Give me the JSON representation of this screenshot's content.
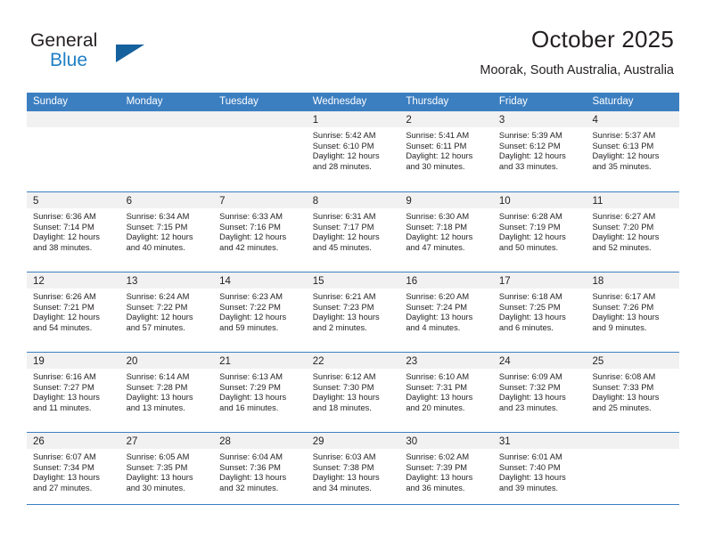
{
  "brand": {
    "word_one": "General",
    "word_two": "Blue",
    "triangle_icon": "triangle-logo-icon",
    "accent_color": "#1f7fc4"
  },
  "header": {
    "title": "October 2025",
    "location": "Moorak, South Australia, Australia"
  },
  "calendar": {
    "header_color": "#3c7fc1",
    "day_band_color": "#f1f1f1",
    "weekdays": [
      "Sunday",
      "Monday",
      "Tuesday",
      "Wednesday",
      "Thursday",
      "Friday",
      "Saturday"
    ],
    "weeks": [
      [
        {
          "day": "",
          "lines": []
        },
        {
          "day": "",
          "lines": []
        },
        {
          "day": "",
          "lines": []
        },
        {
          "day": "1",
          "lines": [
            "Sunrise: 5:42 AM",
            "Sunset: 6:10 PM",
            "Daylight: 12 hours",
            "and 28 minutes."
          ]
        },
        {
          "day": "2",
          "lines": [
            "Sunrise: 5:41 AM",
            "Sunset: 6:11 PM",
            "Daylight: 12 hours",
            "and 30 minutes."
          ]
        },
        {
          "day": "3",
          "lines": [
            "Sunrise: 5:39 AM",
            "Sunset: 6:12 PM",
            "Daylight: 12 hours",
            "and 33 minutes."
          ]
        },
        {
          "day": "4",
          "lines": [
            "Sunrise: 5:37 AM",
            "Sunset: 6:13 PM",
            "Daylight: 12 hours",
            "and 35 minutes."
          ]
        }
      ],
      [
        {
          "day": "5",
          "lines": [
            "Sunrise: 6:36 AM",
            "Sunset: 7:14 PM",
            "Daylight: 12 hours",
            "and 38 minutes."
          ]
        },
        {
          "day": "6",
          "lines": [
            "Sunrise: 6:34 AM",
            "Sunset: 7:15 PM",
            "Daylight: 12 hours",
            "and 40 minutes."
          ]
        },
        {
          "day": "7",
          "lines": [
            "Sunrise: 6:33 AM",
            "Sunset: 7:16 PM",
            "Daylight: 12 hours",
            "and 42 minutes."
          ]
        },
        {
          "day": "8",
          "lines": [
            "Sunrise: 6:31 AM",
            "Sunset: 7:17 PM",
            "Daylight: 12 hours",
            "and 45 minutes."
          ]
        },
        {
          "day": "9",
          "lines": [
            "Sunrise: 6:30 AM",
            "Sunset: 7:18 PM",
            "Daylight: 12 hours",
            "and 47 minutes."
          ]
        },
        {
          "day": "10",
          "lines": [
            "Sunrise: 6:28 AM",
            "Sunset: 7:19 PM",
            "Daylight: 12 hours",
            "and 50 minutes."
          ]
        },
        {
          "day": "11",
          "lines": [
            "Sunrise: 6:27 AM",
            "Sunset: 7:20 PM",
            "Daylight: 12 hours",
            "and 52 minutes."
          ]
        }
      ],
      [
        {
          "day": "12",
          "lines": [
            "Sunrise: 6:26 AM",
            "Sunset: 7:21 PM",
            "Daylight: 12 hours",
            "and 54 minutes."
          ]
        },
        {
          "day": "13",
          "lines": [
            "Sunrise: 6:24 AM",
            "Sunset: 7:22 PM",
            "Daylight: 12 hours",
            "and 57 minutes."
          ]
        },
        {
          "day": "14",
          "lines": [
            "Sunrise: 6:23 AM",
            "Sunset: 7:22 PM",
            "Daylight: 12 hours",
            "and 59 minutes."
          ]
        },
        {
          "day": "15",
          "lines": [
            "Sunrise: 6:21 AM",
            "Sunset: 7:23 PM",
            "Daylight: 13 hours",
            "and 2 minutes."
          ]
        },
        {
          "day": "16",
          "lines": [
            "Sunrise: 6:20 AM",
            "Sunset: 7:24 PM",
            "Daylight: 13 hours",
            "and 4 minutes."
          ]
        },
        {
          "day": "17",
          "lines": [
            "Sunrise: 6:18 AM",
            "Sunset: 7:25 PM",
            "Daylight: 13 hours",
            "and 6 minutes."
          ]
        },
        {
          "day": "18",
          "lines": [
            "Sunrise: 6:17 AM",
            "Sunset: 7:26 PM",
            "Daylight: 13 hours",
            "and 9 minutes."
          ]
        }
      ],
      [
        {
          "day": "19",
          "lines": [
            "Sunrise: 6:16 AM",
            "Sunset: 7:27 PM",
            "Daylight: 13 hours",
            "and 11 minutes."
          ]
        },
        {
          "day": "20",
          "lines": [
            "Sunrise: 6:14 AM",
            "Sunset: 7:28 PM",
            "Daylight: 13 hours",
            "and 13 minutes."
          ]
        },
        {
          "day": "21",
          "lines": [
            "Sunrise: 6:13 AM",
            "Sunset: 7:29 PM",
            "Daylight: 13 hours",
            "and 16 minutes."
          ]
        },
        {
          "day": "22",
          "lines": [
            "Sunrise: 6:12 AM",
            "Sunset: 7:30 PM",
            "Daylight: 13 hours",
            "and 18 minutes."
          ]
        },
        {
          "day": "23",
          "lines": [
            "Sunrise: 6:10 AM",
            "Sunset: 7:31 PM",
            "Daylight: 13 hours",
            "and 20 minutes."
          ]
        },
        {
          "day": "24",
          "lines": [
            "Sunrise: 6:09 AM",
            "Sunset: 7:32 PM",
            "Daylight: 13 hours",
            "and 23 minutes."
          ]
        },
        {
          "day": "25",
          "lines": [
            "Sunrise: 6:08 AM",
            "Sunset: 7:33 PM",
            "Daylight: 13 hours",
            "and 25 minutes."
          ]
        }
      ],
      [
        {
          "day": "26",
          "lines": [
            "Sunrise: 6:07 AM",
            "Sunset: 7:34 PM",
            "Daylight: 13 hours",
            "and 27 minutes."
          ]
        },
        {
          "day": "27",
          "lines": [
            "Sunrise: 6:05 AM",
            "Sunset: 7:35 PM",
            "Daylight: 13 hours",
            "and 30 minutes."
          ]
        },
        {
          "day": "28",
          "lines": [
            "Sunrise: 6:04 AM",
            "Sunset: 7:36 PM",
            "Daylight: 13 hours",
            "and 32 minutes."
          ]
        },
        {
          "day": "29",
          "lines": [
            "Sunrise: 6:03 AM",
            "Sunset: 7:38 PM",
            "Daylight: 13 hours",
            "and 34 minutes."
          ]
        },
        {
          "day": "30",
          "lines": [
            "Sunrise: 6:02 AM",
            "Sunset: 7:39 PM",
            "Daylight: 13 hours",
            "and 36 minutes."
          ]
        },
        {
          "day": "31",
          "lines": [
            "Sunrise: 6:01 AM",
            "Sunset: 7:40 PM",
            "Daylight: 13 hours",
            "and 39 minutes."
          ]
        },
        {
          "day": "",
          "lines": []
        }
      ]
    ]
  }
}
